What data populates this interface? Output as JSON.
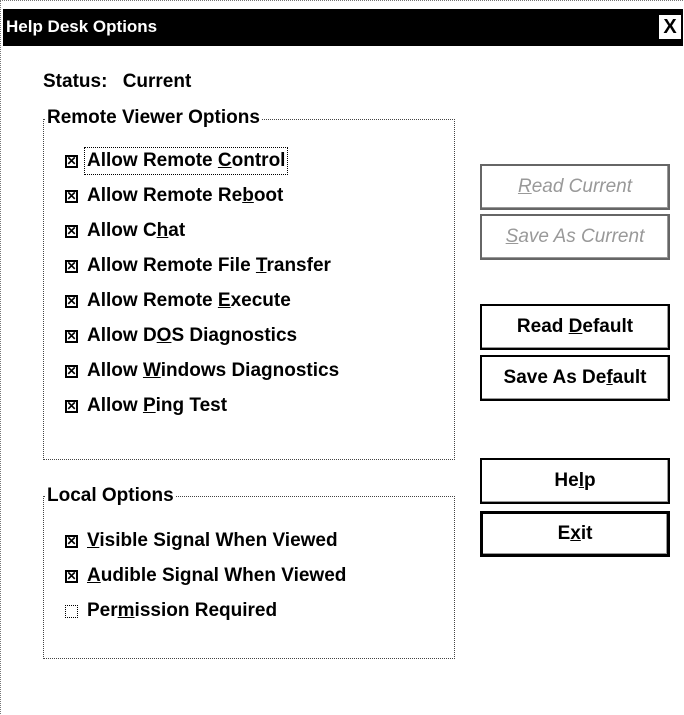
{
  "window": {
    "title": "Help Desk Options",
    "close_glyph": "X"
  },
  "status": {
    "label": "Status:",
    "value": "Current"
  },
  "remote_group": {
    "title": "Remote Viewer Options",
    "items": [
      {
        "pre": "Allow Remote ",
        "u": "C",
        "post": "ontrol",
        "checked": true
      },
      {
        "pre": "Allow Remote Re",
        "u": "b",
        "post": "oot",
        "checked": true
      },
      {
        "pre": "Allow C",
        "u": "h",
        "post": "at",
        "checked": true
      },
      {
        "pre": "Allow Remote File ",
        "u": "T",
        "post": "ransfer",
        "checked": true
      },
      {
        "pre": "Allow Remote ",
        "u": "E",
        "post": "xecute",
        "checked": true
      },
      {
        "pre": "Allow D",
        "u": "O",
        "post": "S Diagnostics",
        "checked": true
      },
      {
        "pre": "Allow ",
        "u": "W",
        "post": "indows Diagnostics",
        "checked": true
      },
      {
        "pre": "Allow ",
        "u": "P",
        "post": "ing Test",
        "checked": true
      }
    ]
  },
  "local_group": {
    "title": "Local Options",
    "items": [
      {
        "pre": "",
        "u": "V",
        "post": "isible Signal When Viewed",
        "checked": true
      },
      {
        "pre": "",
        "u": "A",
        "post": "udible Signal When Viewed",
        "checked": true
      },
      {
        "pre": "Per",
        "u": "m",
        "post": "ission Required",
        "checked": false
      }
    ]
  },
  "buttons": {
    "read_current": {
      "pre": "",
      "u": "R",
      "post": "ead Current",
      "enabled": false
    },
    "save_as_current": {
      "pre": "",
      "u": "S",
      "post": "ave As Current",
      "enabled": false
    },
    "read_default": {
      "pre": "Read ",
      "u": "D",
      "post": "efault",
      "enabled": true
    },
    "save_as_default": {
      "pre": "Save As De",
      "u": "f",
      "post": "ault",
      "enabled": true
    },
    "help": {
      "pre": "He",
      "u": "l",
      "post": "p",
      "enabled": true
    },
    "exit": {
      "pre": "E",
      "u": "x",
      "post": "it",
      "enabled": true
    }
  }
}
